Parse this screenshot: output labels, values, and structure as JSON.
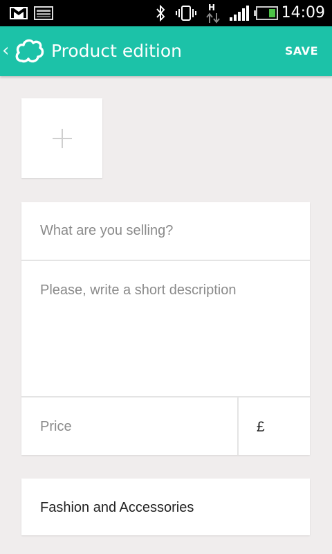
{
  "status_bar": {
    "time": "14:09",
    "icons": [
      "gmail-icon",
      "photo-notification-icon",
      "bluetooth-icon",
      "vibrate-icon",
      "hspa-data-icon",
      "signal-icon",
      "battery-icon"
    ]
  },
  "app_bar": {
    "title": "Product edition",
    "save_label": "SAVE",
    "icons": [
      "back-chevron-icon",
      "cloud-logo-icon"
    ]
  },
  "photo": {
    "icon": "plus-icon"
  },
  "form": {
    "title_placeholder": "What are you selling?",
    "description_placeholder": "Please, write a short description",
    "price_placeholder": "Price",
    "currency_symbol": "£"
  },
  "category": {
    "value": "Fashion and Accessories"
  },
  "colors": {
    "accent": "#1cc2a8",
    "background": "#f0eded",
    "status_bar": "#000000"
  }
}
